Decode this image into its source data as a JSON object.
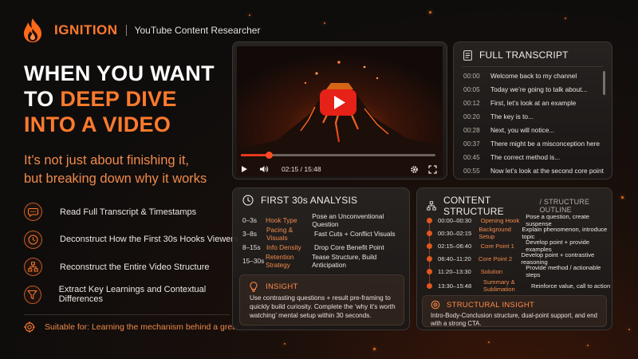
{
  "brand": {
    "name": "IGNITION",
    "subtitle": "YouTube Content Researcher"
  },
  "hero": {
    "line1": "WHEN YOU WANT",
    "line2_prefix": "TO ",
    "line2_highlight": "DEEP DIVE",
    "line3": "INTO A VIDEO",
    "tagline_line1": "It’s not just about finishing it,",
    "tagline_line2": "but breaking down why it works"
  },
  "features": [
    {
      "icon": "chat-bubble-icon",
      "label": "Read Full Transcript & Timestamps"
    },
    {
      "icon": "clock-icon",
      "label": "Deconstruct How the First 30s Hooks Viewers"
    },
    {
      "icon": "structure-icon",
      "label": "Reconstruct the Entire Video Structure"
    },
    {
      "icon": "filter-icon",
      "label": "Extract Key Learnings and Contextual Differences"
    }
  ],
  "suitable": "Suitable for: Learning the mechanism behind a great video",
  "video": {
    "time": "02:15 / 15:48",
    "progress": 0.142
  },
  "transcript": {
    "title": "FULL TRANSCRIPT",
    "rows": [
      {
        "t": "00:00",
        "text": "Welcome back to my channel"
      },
      {
        "t": "00:05",
        "text": "Today we’re going to talk about..."
      },
      {
        "t": "00:12",
        "text": "First, let’s look at an example"
      },
      {
        "t": "00:20",
        "text": "The key is to..."
      },
      {
        "t": "00:28",
        "text": "Next, you will notice..."
      },
      {
        "t": "00:37",
        "text": "There might be a misconception here"
      },
      {
        "t": "00:45",
        "text": "The correct method is..."
      },
      {
        "t": "00:55",
        "text": "Now let’s look at the second core point"
      }
    ]
  },
  "first30": {
    "title": "FIRST 30s ANALYSIS",
    "rows": [
      {
        "time": "0–3s",
        "label": "Hook Type",
        "desc": "Pose an Unconventional Question"
      },
      {
        "time": "3–8s",
        "label": "Pacing & Visuals",
        "desc": "Fast Cuts + Conflict Visuals"
      },
      {
        "time": "8–15s",
        "label": "Info Density",
        "desc": "Drop Core Benefit Point"
      },
      {
        "time": "15–30s",
        "label": "Retention Strategy",
        "desc": "Tease Structure, Build Anticipation"
      }
    ],
    "insight_title": "INSIGHT",
    "insight_body": "Use contrasting questions + result pre-framing to quickly build curiosity. Complete the ‘why it’s worth watching’ mental setup within 30 seconds."
  },
  "structure": {
    "title": "CONTENT STRUCTURE",
    "subtitle": "/ STRUCTURE OUTLINE",
    "rows": [
      {
        "time": "00:00–00:30",
        "name": "Opening Hook",
        "desc": "Pose a question, create suspense"
      },
      {
        "time": "00:30–02:15",
        "name": "Background Setup",
        "desc": "Explain phenomenon, introduce topic"
      },
      {
        "time": "02:15–06:40",
        "name": "Core Point 1",
        "desc": "Develop point + provide examples"
      },
      {
        "time": "06:40–11:20",
        "name": "Core Point 2",
        "desc": "Develop point + contrastive reasoning"
      },
      {
        "time": "11:20–13:30",
        "name": "Solution",
        "desc": "Provide method / actionable steps"
      },
      {
        "time": "13:30–15:48",
        "name": "Summary & Sublimation",
        "desc": "Reinforce value, call to action"
      }
    ],
    "insight_title": "STRUCTURAL INSIGHT",
    "insight_body": "Intro-Body-Conclusion structure, dual-point support, and end with a strong CTA."
  },
  "colors": {
    "accent": "#ff7a2e",
    "background": "#0f0d0c",
    "panel": "#221e1c",
    "video_red": "#e62117"
  }
}
